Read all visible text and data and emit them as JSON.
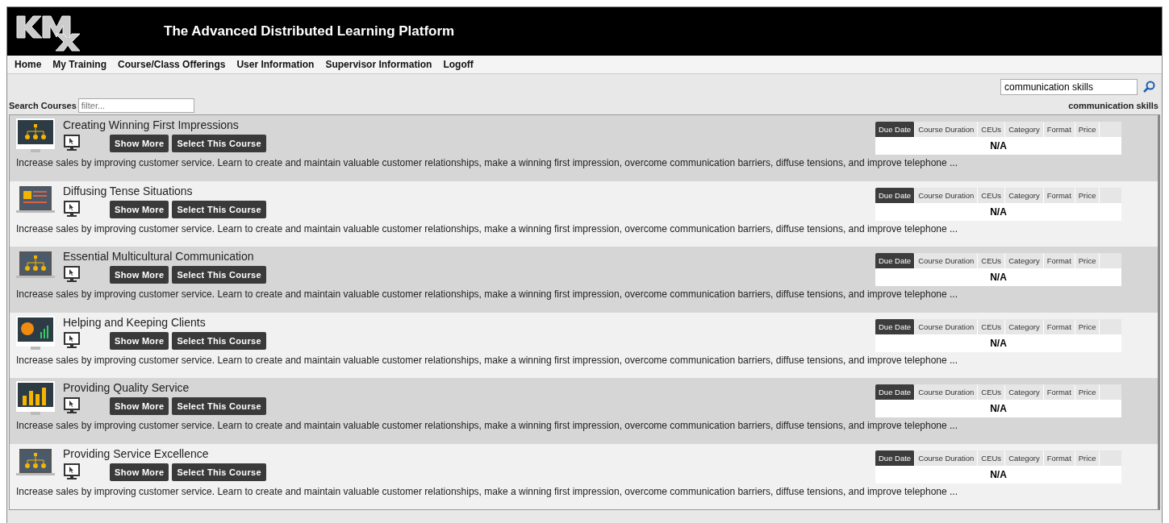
{
  "header": {
    "title": "The Advanced Distributed Learning Platform"
  },
  "nav": [
    "Home",
    "My Training",
    "Course/Class Offerings",
    "User Information",
    "Supervisor Information",
    "Logoff"
  ],
  "search": {
    "value": "communication skills",
    "caption": "communication skills"
  },
  "filter": {
    "label": "Search Courses",
    "placeholder": "filter..."
  },
  "courses": [
    {
      "title": "Creating Winning First Impressions",
      "show_more": "Show More",
      "select": "Select This Course",
      "description": "Increase sales by improving customer service. Learn to create and maintain valuable customer relationships, make a winning first impression, overcome communication barriers, diffuse tensions, and improve telephone ...",
      "tabs": [
        {
          "label": "Due Date",
          "selected": true
        },
        {
          "label": "Course Duration",
          "selected": false
        },
        {
          "label": "CEUs",
          "selected": false
        },
        {
          "label": "Category",
          "selected": false
        },
        {
          "label": "Format",
          "selected": false
        },
        {
          "label": "Price",
          "selected": false
        }
      ],
      "value": "N/A"
    },
    {
      "title": "Diffusing Tense Situations",
      "show_more": "Show More",
      "select": "Select This Course",
      "description": "Increase sales by improving customer service. Learn to create and maintain valuable customer relationships, make a winning first impression, overcome communication barriers, diffuse tensions, and improve telephone ...",
      "tabs": [
        {
          "label": "Due Date",
          "selected": true
        },
        {
          "label": "Course Duration",
          "selected": false
        },
        {
          "label": "CEUs",
          "selected": false
        },
        {
          "label": "Category",
          "selected": false
        },
        {
          "label": "Format",
          "selected": false
        },
        {
          "label": "Price",
          "selected": false
        }
      ],
      "value": "N/A"
    },
    {
      "title": "Essential Multicultural Communication",
      "show_more": "Show More",
      "select": "Select This Course",
      "description": "Increase sales by improving customer service. Learn to create and maintain valuable customer relationships, make a winning first impression, overcome communication barriers, diffuse tensions, and improve telephone ...",
      "tabs": [
        {
          "label": "Due Date",
          "selected": true
        },
        {
          "label": "Course Duration",
          "selected": false
        },
        {
          "label": "CEUs",
          "selected": false
        },
        {
          "label": "Category",
          "selected": false
        },
        {
          "label": "Format",
          "selected": false
        },
        {
          "label": "Price",
          "selected": false
        }
      ],
      "value": "N/A"
    },
    {
      "title": "Helping and Keeping Clients",
      "show_more": "Show More",
      "select": "Select This Course",
      "description": "Increase sales by improving customer service. Learn to create and maintain valuable customer relationships, make a winning first impression, overcome communication barriers, diffuse tensions, and improve telephone ...",
      "tabs": [
        {
          "label": "Due Date",
          "selected": true
        },
        {
          "label": "Course Duration",
          "selected": false
        },
        {
          "label": "CEUs",
          "selected": false
        },
        {
          "label": "Category",
          "selected": false
        },
        {
          "label": "Format",
          "selected": false
        },
        {
          "label": "Price",
          "selected": false
        }
      ],
      "value": "N/A"
    },
    {
      "title": "Providing Quality Service",
      "show_more": "Show More",
      "select": "Select This Course",
      "description": "Increase sales by improving customer service. Learn to create and maintain valuable customer relationships, make a winning first impression, overcome communication barriers, diffuse tensions, and improve telephone ...",
      "tabs": [
        {
          "label": "Due Date",
          "selected": true
        },
        {
          "label": "Course Duration",
          "selected": false
        },
        {
          "label": "CEUs",
          "selected": false
        },
        {
          "label": "Category",
          "selected": false
        },
        {
          "label": "Format",
          "selected": false
        },
        {
          "label": "Price",
          "selected": false
        }
      ],
      "value": "N/A"
    },
    {
      "title": "Providing Service Excellence",
      "show_more": "Show More",
      "select": "Select This Course",
      "description": "Increase sales by improving customer service. Learn to create and maintain valuable customer relationships, make a winning first impression, overcome communication barriers, diffuse tensions, and improve telephone ...",
      "tabs": [
        {
          "label": "Due Date",
          "selected": true
        },
        {
          "label": "Course Duration",
          "selected": false
        },
        {
          "label": "CEUs",
          "selected": false
        },
        {
          "label": "Category",
          "selected": false
        },
        {
          "label": "Format",
          "selected": false
        },
        {
          "label": "Price",
          "selected": false
        }
      ],
      "value": "N/A"
    }
  ]
}
